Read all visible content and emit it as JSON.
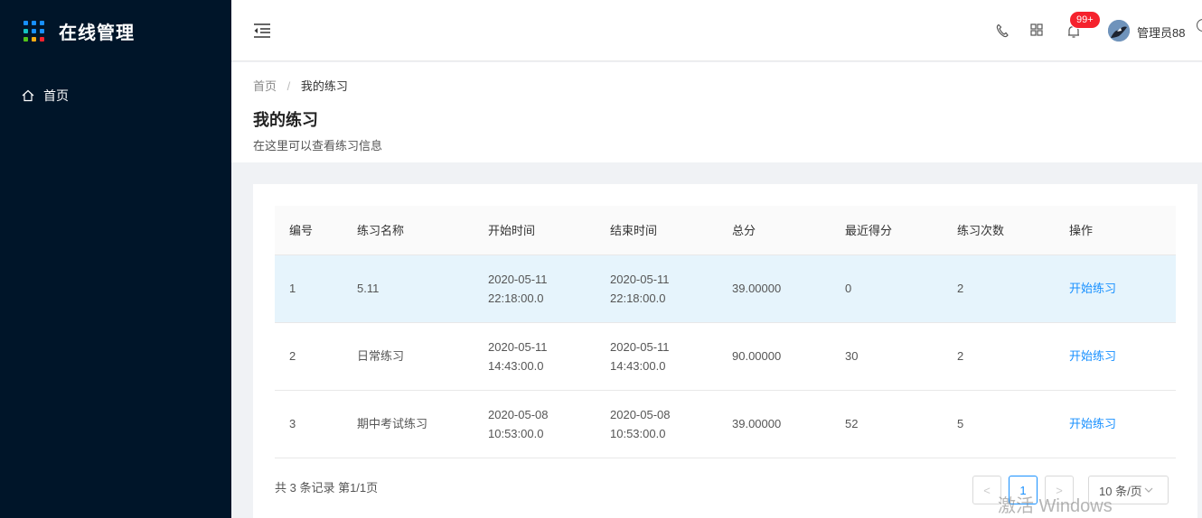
{
  "app": {
    "title": "在线管理",
    "logo_colors": [
      "#1890ff",
      "#1890ff",
      "#1890ff",
      "#13c2c2",
      "#1890ff",
      "#1890ff",
      "#52c41a",
      "#faad14",
      "#f5222d"
    ]
  },
  "sidebar": {
    "items": [
      {
        "label": "首页",
        "icon": "home-icon"
      }
    ]
  },
  "header": {
    "notification_count": "99+",
    "username": "管理员88"
  },
  "breadcrumb": {
    "home": "首页",
    "current": "我的练习"
  },
  "page": {
    "title": "我的练习",
    "subtitle": "在这里可以查看练习信息"
  },
  "table": {
    "columns": [
      "编号",
      "练习名称",
      "开始时间",
      "结束时间",
      "总分",
      "最近得分",
      "练习次数",
      "操作"
    ],
    "rows": [
      {
        "id": "1",
        "name": "5.11",
        "start_date": "2020-05-11",
        "start_time": "22:18:00.0",
        "end_date": "2020-05-11",
        "end_time": "22:18:00.0",
        "total": "39.00000",
        "recent": "0",
        "count": "2",
        "action": "开始练习"
      },
      {
        "id": "2",
        "name": "日常练习",
        "start_date": "2020-05-11",
        "start_time": "14:43:00.0",
        "end_date": "2020-05-11",
        "end_time": "14:43:00.0",
        "total": "90.00000",
        "recent": "30",
        "count": "2",
        "action": "开始练习"
      },
      {
        "id": "3",
        "name": "期中考试练习",
        "start_date": "2020-05-08",
        "start_time": "10:53:00.0",
        "end_date": "2020-05-08",
        "end_time": "10:53:00.0",
        "total": "39.00000",
        "recent": "52",
        "count": "5",
        "action": "开始练习"
      }
    ]
  },
  "pagination": {
    "summary": "共 3 条记录 第1/1页",
    "current_page": "1",
    "prev": "<",
    "next": ">",
    "page_size": "10 条/页"
  },
  "watermark": "激活 Windows",
  "colors": {
    "sidebar_bg": "#001529",
    "accent": "#1890ff",
    "highlight_row": "#e6f4fc",
    "badge": "#f5222d"
  }
}
